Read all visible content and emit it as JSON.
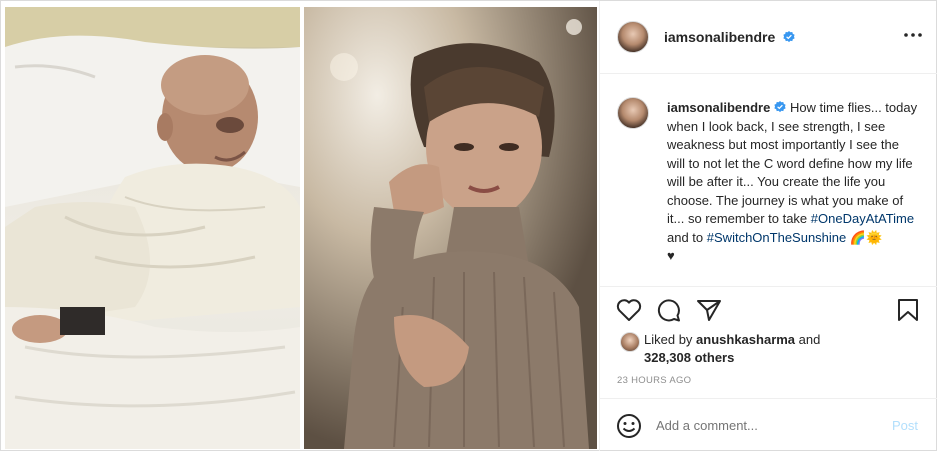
{
  "post": {
    "username": "iamsonalibendre",
    "caption_user": "iamsonalibendre",
    "caption_text": "How time flies... today when I look back, I see strength, I see weakness but most importantly I see the will to not let the C word define how my life will be after it... You create the life you choose. The journey is what you make of it... so remember to take",
    "hashtag1": "#OneDayAtATime",
    "and_to": "and to",
    "hashtag2": "#SwitchOnTheSunshine",
    "emoji": "🌈🌞",
    "heart": "♥",
    "liked_by_prefix": "Liked by",
    "liked_by_user": "anushkasharma",
    "liked_by_and": "and",
    "others_count": "328,308 others",
    "timestamp": "23 HOURS AGO",
    "comment_placeholder": "Add a comment...",
    "post_label": "Post"
  },
  "colors": {
    "hashtag": "#00376b",
    "verified": "#3897f0",
    "post_disabled": "#b2dffc",
    "muted": "#8e8e8e"
  },
  "icons": [
    "verified-badge-icon",
    "more-options-icon",
    "like-heart-icon",
    "comment-icon",
    "share-icon",
    "save-bookmark-icon",
    "emoji-icon"
  ]
}
